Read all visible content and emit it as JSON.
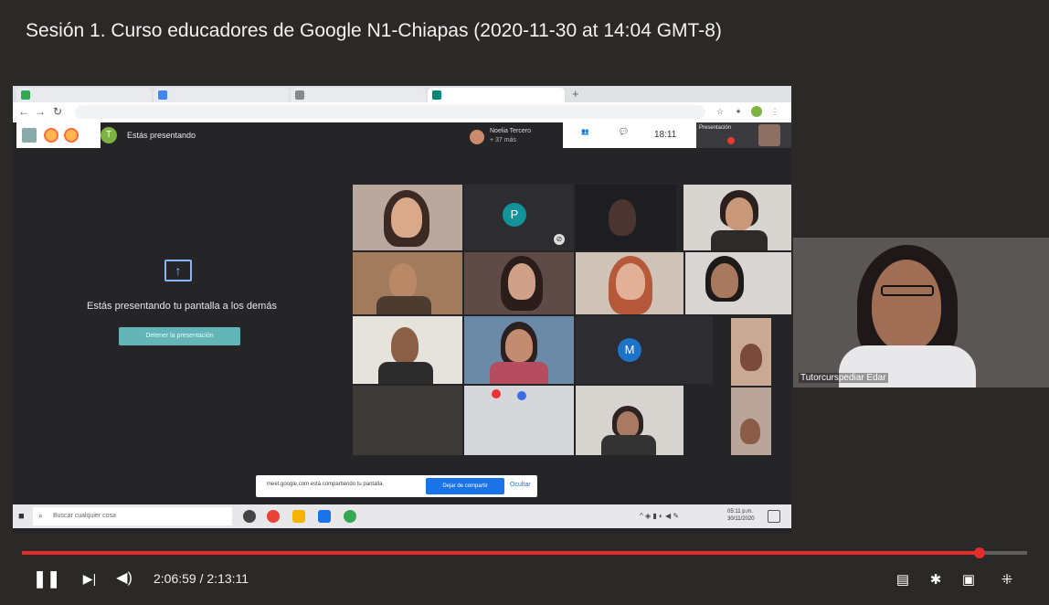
{
  "video": {
    "title": "Sesión 1. Curso educadores de Google N1-Chiapas (2020-11-30 at 14:04 GMT-8)"
  },
  "meet": {
    "presenting_label": "Estás presentando",
    "avatar_letter": "T",
    "participant_name": "Noelia Tercero",
    "participant_more": "+ 37 más",
    "clock": "18:11",
    "presentation_chip": "Presentación",
    "share_message": "Estás presentando tu pantalla a los demás",
    "stop_button": "Detener la presentación",
    "tile_letter_p": "P",
    "tile_letter_m": "M",
    "presenter_name": "Tutorcurspediar Edar"
  },
  "notification": {
    "text": "meet.google.com está compartiendo tu pantalla.",
    "stop_button": "Dejar de compartir",
    "hide": "Ocultar"
  },
  "taskbar": {
    "search_placeholder": "Buscar cualquier cosa",
    "time": "05:11 p.m.",
    "date": "30/11/2020"
  },
  "player": {
    "current_time": "2:06:59",
    "duration": "2:13:11",
    "time_separator": " / ",
    "progress_fraction": 0.953
  },
  "colors": {
    "progress": "#e52c2c",
    "meet_stop": "#64b5b8"
  }
}
